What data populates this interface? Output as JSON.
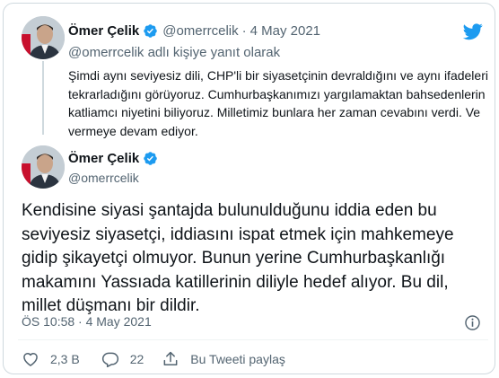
{
  "colors": {
    "accent": "#1d9bf0",
    "text": "#0f1419",
    "muted": "#536471",
    "border": "#cfd9de"
  },
  "icons": [
    "twitter-logo-icon",
    "verified-badge-icon",
    "info-icon",
    "heart-icon",
    "reply-icon",
    "share-icon"
  ],
  "parent_tweet": {
    "author_name": "Ömer Çelik",
    "handle": "@omerrcelik",
    "separator": "·",
    "date": "4 May 2021",
    "reply_to": "@omerrcelik adlı kişiye yanıt olarak",
    "text": "Şimdi aynı seviyesiz dili, CHP'li bir siyasetçinin devraldığını ve aynı ifadeleri tekrarladığını görüyoruz. Cumhurbaşkanımızı yargılamaktan bahsedenlerin katliamcı niyetini biliyoruz. Milletimiz bunlara her zaman cevabını verdi. Ve vermeye devam ediyor."
  },
  "main_tweet": {
    "author_name": "Ömer Çelik",
    "handle": "@omerrcelik",
    "text": "Kendisine siyasi şantajda bulunulduğunu iddia eden bu seviyesiz siyasetçi, iddiasını ispat etmek için mahkemeye gidip şikayetçi olmuyor. Bunun yerine Cumhurbaşkanlığı makamını Yassıada katillerinin diliyle hedef alıyor. Bu dil, millet düşmanı bir dildir.",
    "timestamp": "ÖS 10:58 · 4 May 2021"
  },
  "actions": {
    "likes": "2,3 B",
    "replies": "22",
    "share_label": "Bu Tweeti paylaş"
  }
}
